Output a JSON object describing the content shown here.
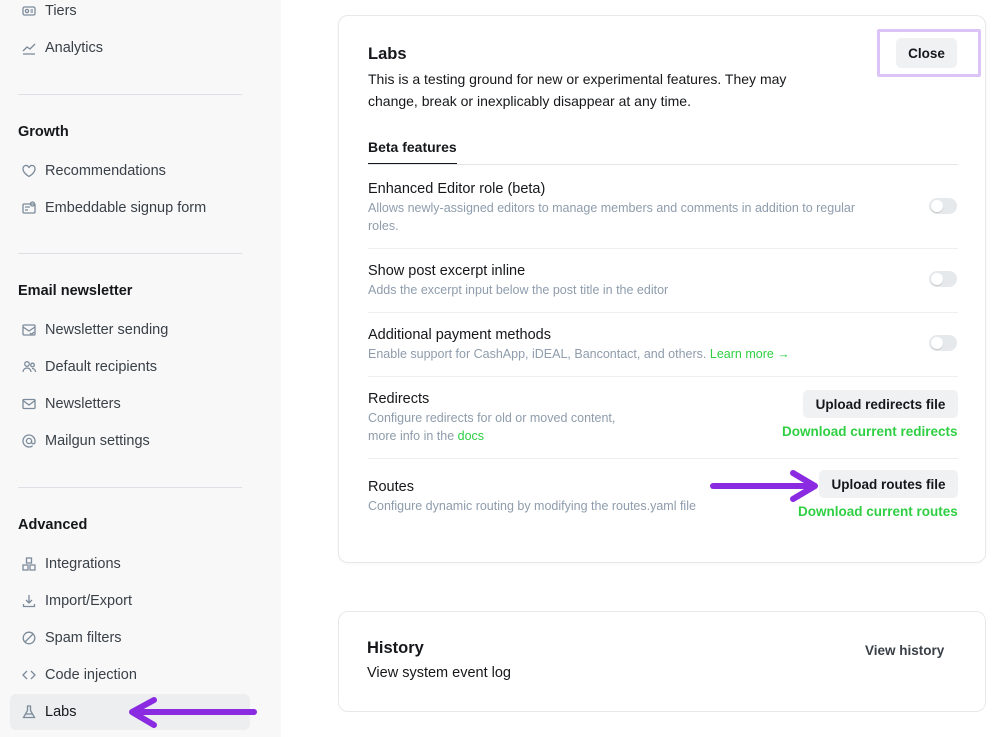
{
  "sidebar": {
    "items_top": [
      {
        "label": "Tiers",
        "icon": "tiers-icon"
      },
      {
        "label": "Analytics",
        "icon": "analytics-icon"
      }
    ],
    "growth": {
      "title": "Growth",
      "items": [
        {
          "label": "Recommendations",
          "icon": "heart-icon"
        },
        {
          "label": "Embeddable signup form",
          "icon": "signup-form-icon"
        }
      ]
    },
    "email": {
      "title": "Email newsletter",
      "items": [
        {
          "label": "Newsletter sending",
          "icon": "mail-check-icon"
        },
        {
          "label": "Default recipients",
          "icon": "users-icon"
        },
        {
          "label": "Newsletters",
          "icon": "envelope-icon"
        },
        {
          "label": "Mailgun settings",
          "icon": "at-icon"
        }
      ]
    },
    "advanced": {
      "title": "Advanced",
      "items": [
        {
          "label": "Integrations",
          "icon": "integrations-icon"
        },
        {
          "label": "Import/Export",
          "icon": "download-icon"
        },
        {
          "label": "Spam filters",
          "icon": "block-icon"
        },
        {
          "label": "Code injection",
          "icon": "code-icon"
        },
        {
          "label": "Labs",
          "icon": "flask-icon",
          "active": true
        }
      ]
    }
  },
  "labs": {
    "title": "Labs",
    "description": "This is a testing ground for new or experimental features. They may change, break or inexplicably disappear at any time.",
    "close_label": "Close",
    "tab_label": "Beta features",
    "features": [
      {
        "title": "Enhanced Editor role (beta)",
        "description": "Allows newly-assigned editors to manage members and comments in addition to regular roles.",
        "enabled": false
      },
      {
        "title": "Show post excerpt inline",
        "description": "Adds the excerpt input below the post title in the editor",
        "enabled": false
      },
      {
        "title": "Additional payment methods",
        "description": "Enable support for CashApp, iDEAL, Bancontact, and others.",
        "link": "Learn more →",
        "enabled": false
      }
    ],
    "redirects": {
      "title": "Redirects",
      "description_line1": "Configure redirects for old or moved content,",
      "description_line2": "more info in the",
      "docs_link": "docs",
      "upload_label": "Upload redirects file",
      "download_label": "Download current redirects"
    },
    "routes": {
      "title": "Routes",
      "description": "Configure dynamic routing by modifying the routes.yaml file",
      "upload_label": "Upload routes file",
      "download_label": "Download current routes"
    }
  },
  "history": {
    "title": "History",
    "description": "View system event log",
    "button_label": "View history"
  },
  "colors": {
    "accent_green": "#30cf43",
    "annotation_purple": "#8a2be2",
    "highlight_lavender": "#dcc5f6"
  }
}
